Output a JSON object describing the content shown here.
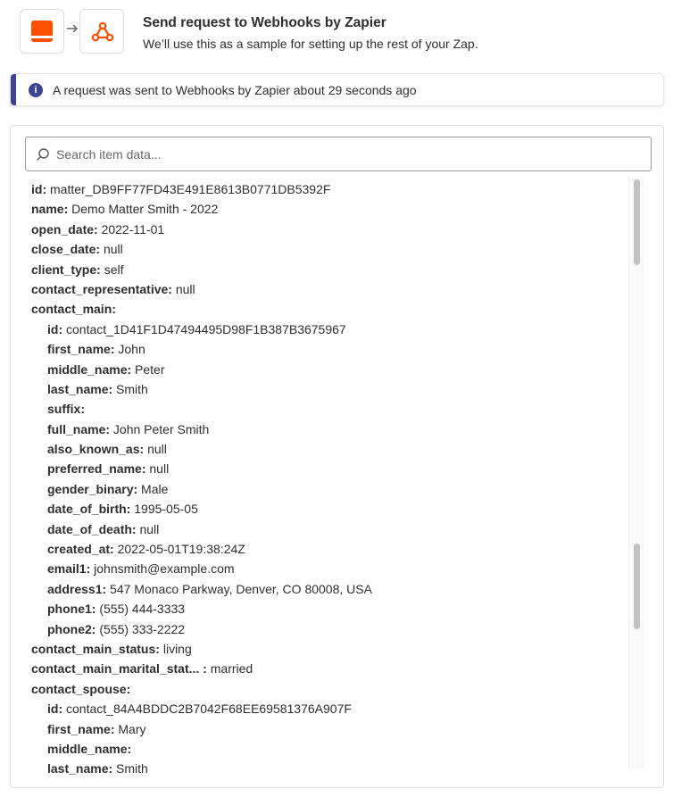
{
  "header": {
    "title": "Send request to Webhooks by Zapier",
    "subtitle": "We’ll use this as a sample for setting up the rest of your Zap.",
    "source_app_icon": "app-icon",
    "target_app_icon": "webhooks-icon"
  },
  "notice": {
    "text": "A request was sent to Webhooks by Zapier about 29 seconds ago",
    "icon": "info-icon"
  },
  "search": {
    "placeholder": "Search item data...",
    "value": ""
  },
  "items": [
    {
      "key": "id",
      "value": "matter_DB9FF77FD43E491E8613B0771DB5392F",
      "level": 0
    },
    {
      "key": "name",
      "value": "Demo Matter Smith - 2022",
      "level": 0
    },
    {
      "key": "open_date",
      "value": "2022-11-01",
      "level": 0
    },
    {
      "key": "close_date",
      "value": "null",
      "level": 0
    },
    {
      "key": "client_type",
      "value": "self",
      "level": 0
    },
    {
      "key": "contact_representative",
      "value": "null",
      "level": 0
    },
    {
      "key": "contact_main",
      "value": "",
      "level": 0
    },
    {
      "key": "id",
      "value": "contact_1D41F1D47494495D98F1B387B3675967",
      "level": 1
    },
    {
      "key": "first_name",
      "value": "John",
      "level": 1
    },
    {
      "key": "middle_name",
      "value": "Peter",
      "level": 1
    },
    {
      "key": "last_name",
      "value": "Smith",
      "level": 1
    },
    {
      "key": "suffix",
      "value": "",
      "level": 1
    },
    {
      "key": "full_name",
      "value": "John Peter Smith",
      "level": 1
    },
    {
      "key": "also_known_as",
      "value": "null",
      "level": 1
    },
    {
      "key": "preferred_name",
      "value": "null",
      "level": 1
    },
    {
      "key": "gender_binary",
      "value": "Male",
      "level": 1
    },
    {
      "key": "date_of_birth",
      "value": "1995-05-05",
      "level": 1
    },
    {
      "key": "date_of_death",
      "value": "null",
      "level": 1
    },
    {
      "key": "created_at",
      "value": "2022-05-01T19:38:24Z",
      "level": 1
    },
    {
      "key": "email1",
      "value": "johnsmith@example.com",
      "level": 1
    },
    {
      "key": "address1",
      "value": "547 Monaco Parkway, Denver, CO 80008, USA",
      "level": 1
    },
    {
      "key": "phone1",
      "value": "(555) 444-3333",
      "level": 1
    },
    {
      "key": "phone2",
      "value": "(555) 333-2222",
      "level": 1
    },
    {
      "key": "contact_main_status",
      "value": "living",
      "level": 0
    },
    {
      "key": "contact_main_marital_stat...",
      "value": "married",
      "level": 0
    },
    {
      "key": "contact_spouse",
      "value": "",
      "level": 0
    },
    {
      "key": "id",
      "value": "contact_84A4BDDC2B7042F68EE69581376A907F",
      "level": 1
    },
    {
      "key": "first_name",
      "value": "Mary",
      "level": 1
    },
    {
      "key": "middle_name",
      "value": "",
      "level": 1
    },
    {
      "key": "last_name",
      "value": "Smith",
      "level": 1
    }
  ],
  "colors": {
    "accent": "#ff4f00",
    "notice_bar": "#3d4592"
  }
}
